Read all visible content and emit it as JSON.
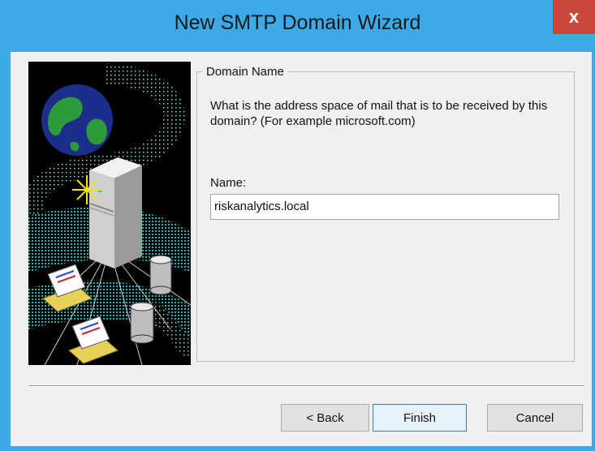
{
  "window": {
    "title": "New SMTP Domain Wizard",
    "close_label": "x"
  },
  "group": {
    "legend": "Domain Name"
  },
  "description": "What is the address space of mail that is to be received by this domain? (For example microsoft.com)",
  "name_field": {
    "label": "Name:",
    "value": "riskanalytics.local"
  },
  "buttons": {
    "back": "< Back",
    "finish": "Finish",
    "cancel": "Cancel"
  },
  "colors": {
    "titlebar": "#3da9e6",
    "close": "#c9483b",
    "dialog_bg": "#f0f0f0",
    "art_teal": "#1fb7b0"
  },
  "illustration": {
    "icons": [
      "globe-icon",
      "server-icon",
      "sparkle-icon",
      "envelope-icon",
      "mail-tray-icon",
      "cylinder-icon"
    ]
  }
}
